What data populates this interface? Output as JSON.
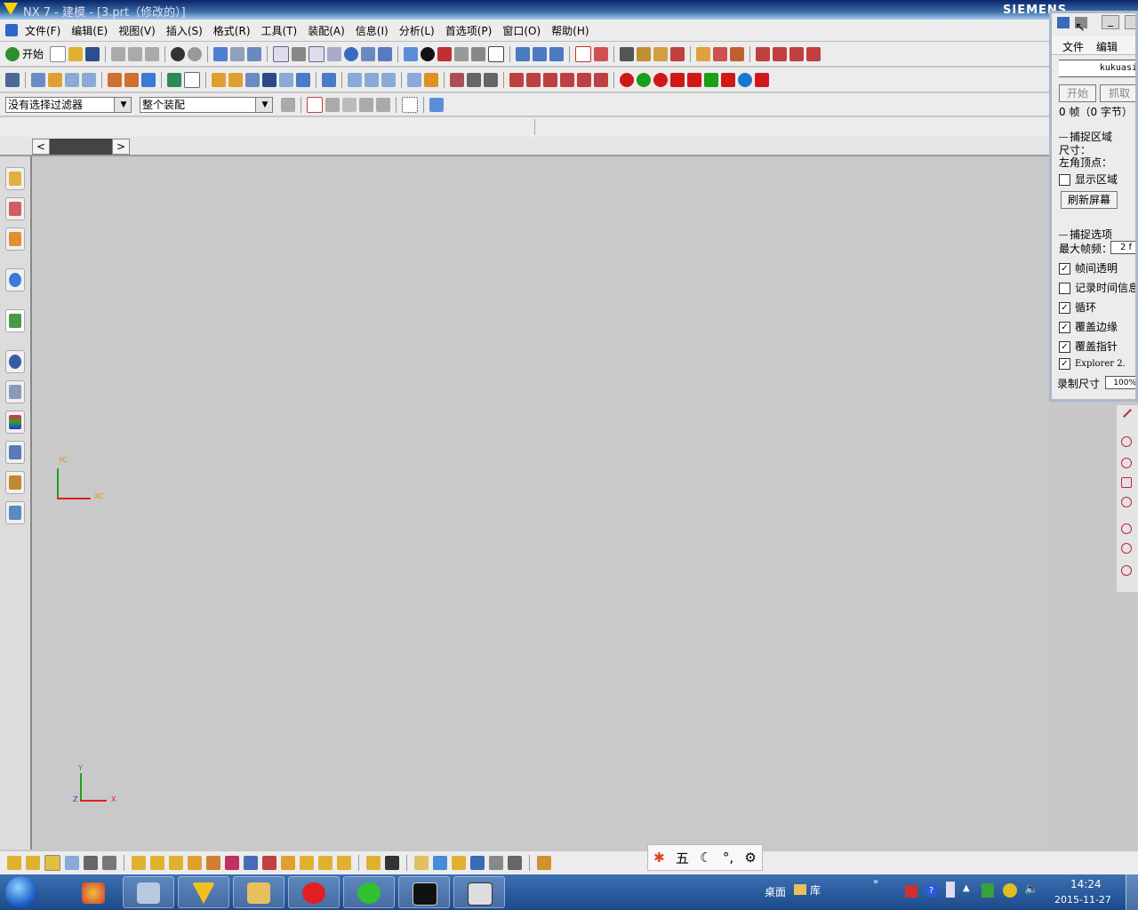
{
  "window": {
    "title": "NX 7 - 建模 - [3.prt（修改的）]",
    "brand": "SIEMENS"
  },
  "menu": [
    "文件(F)",
    "编辑(E)",
    "视图(V)",
    "插入(S)",
    "格式(R)",
    "工具(T)",
    "装配(A)",
    "信息(I)",
    "分析(L)",
    "首选项(P)",
    "窗口(O)",
    "帮助(H)"
  ],
  "toolbar": {
    "start_label": "开始"
  },
  "filters": {
    "selection_filter": "没有选择过滤器",
    "scope": "整个装配"
  },
  "axes": {
    "wcs": {
      "y": "YC",
      "x": "XC"
    },
    "abs": {
      "y": "Y",
      "x": "X",
      "z": "Z"
    }
  },
  "snagit": {
    "menu": [
      "文件",
      "编辑"
    ],
    "name_field": "kukuasi",
    "start_button": "开始",
    "capture_button": "抓取",
    "frames": "0 帧（0 字节）",
    "capture_area": "捕捉区域",
    "size_label": "尺寸：",
    "corner_label": "左角顶点：",
    "show_area": "显示区域",
    "refresh": "刷新屏幕",
    "capture_options": "捕捉选项",
    "max_fps_label": "最大帧频：",
    "max_fps_value": "2 f",
    "options": [
      {
        "label": "帧间透明",
        "checked": true
      },
      {
        "label": "记录时间信息",
        "checked": false
      },
      {
        "label": "循环",
        "checked": true
      },
      {
        "label": "覆盖边缘",
        "checked": true
      },
      {
        "label": "覆盖指针",
        "checked": true
      },
      {
        "label": "Explorer 2.",
        "checked": true
      }
    ],
    "record_size_label": "录制尺寸",
    "record_size_value": "100%"
  },
  "ime": {
    "mode": "五"
  },
  "taskbar": {
    "desktop": "桌面",
    "library": "库",
    "time": "14:24",
    "date": "2015-11-27"
  },
  "colors": {
    "axis_x": "#e02020",
    "axis_y": "#20a020",
    "wcs_label": "#e09020"
  }
}
